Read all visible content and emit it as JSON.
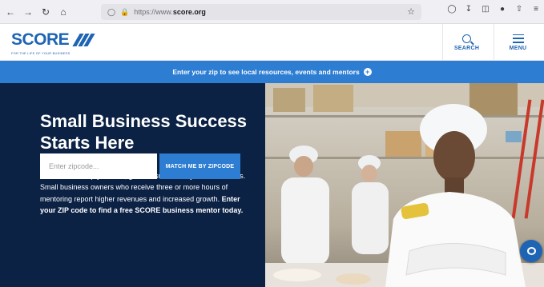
{
  "browser": {
    "back_icon": "back-arrow-icon",
    "forward_icon": "forward-arrow-icon",
    "reload_icon": "reload-icon",
    "home_icon": "home-icon",
    "url_prefix": "https://www.",
    "url_domain": "score.org",
    "bookmark_icon": "star-icon"
  },
  "header": {
    "logo_text": "SCORE",
    "logo_tagline": "FOR THE LIFE OF YOUR BUSINESS",
    "search_label": "SEARCH",
    "menu_label": "MENU"
  },
  "banner": {
    "text": "Enter your zip to see local resources, events and mentors"
  },
  "hero": {
    "title": "Small Business Success Starts Here",
    "body_plain": "SCORE can help you start, grow or successfully exit a business. Small business owners who receive three or more hours of mentoring report higher revenues and increased growth. ",
    "body_bold": "Enter your ZIP code to find a free SCORE business mentor today.",
    "zip_placeholder": "Enter zipcode...",
    "match_button": "MATCH ME BY ZIPCODE"
  },
  "colors": {
    "brand_blue": "#1e64b4",
    "banner_blue": "#2d7dd2",
    "hero_navy": "#0c2245",
    "accent_gold": "#f2b705"
  }
}
